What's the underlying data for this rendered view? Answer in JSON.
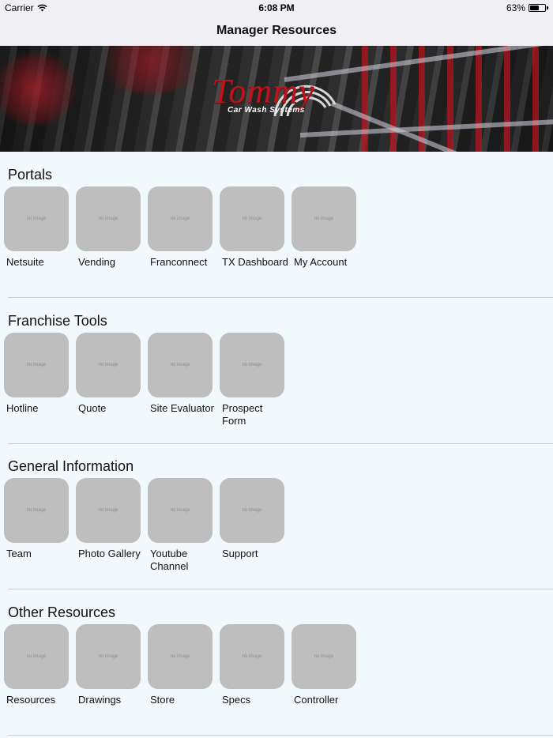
{
  "status_bar": {
    "carrier": "Carrier",
    "time": "6:08 PM",
    "battery": "63%",
    "battery_level": 0.63
  },
  "nav": {
    "title": "Manager Resources"
  },
  "banner": {
    "logo_text": "Tommy",
    "logo_subtext": "Car Wash Systems"
  },
  "tile_placeholder": "no image",
  "sections": [
    {
      "title": "Portals",
      "items": [
        "Netsuite",
        "Vending",
        "Franconnect",
        "TX Dashboard",
        "My Account"
      ]
    },
    {
      "title": "Franchise Tools",
      "items": [
        "Hotline",
        "Quote",
        "Site Evaluator",
        "Prospect Form"
      ]
    },
    {
      "title": "General Information",
      "items": [
        "Team",
        "Photo Gallery",
        "Youtube Channel",
        "Support"
      ]
    },
    {
      "title": "Other Resources",
      "items": [
        "Resources",
        "Drawings",
        "Store",
        "Specs",
        "Controller"
      ]
    }
  ]
}
